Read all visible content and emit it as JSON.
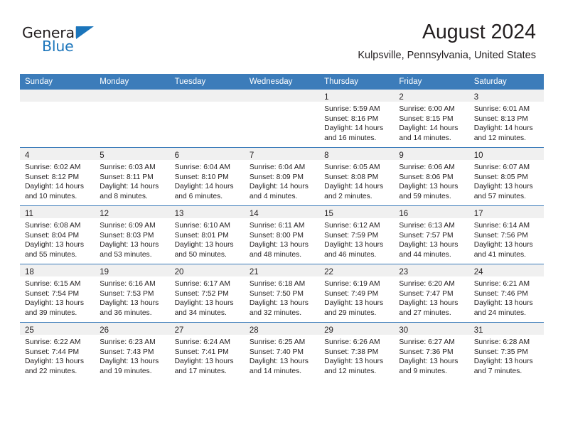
{
  "logo": {
    "word1": "General",
    "word2": "Blue",
    "triangle_color": "#1b75bb"
  },
  "header": {
    "month_title": "August 2024",
    "location": "Kulpsville, Pennsylvania, United States"
  },
  "theme": {
    "header_row_color": "#3c7cba",
    "daynum_band_color": "#f0f0f0",
    "text_color": "#231f20"
  },
  "calendar": {
    "weekday_headers": [
      "Sunday",
      "Monday",
      "Tuesday",
      "Wednesday",
      "Thursday",
      "Friday",
      "Saturday"
    ],
    "weeks": [
      [
        {
          "day": "",
          "empty": true
        },
        {
          "day": "",
          "empty": true
        },
        {
          "day": "",
          "empty": true
        },
        {
          "day": "",
          "empty": true
        },
        {
          "day": "1",
          "sunrise": "Sunrise: 5:59 AM",
          "sunset": "Sunset: 8:16 PM",
          "daylight": "Daylight: 14 hours and 16 minutes."
        },
        {
          "day": "2",
          "sunrise": "Sunrise: 6:00 AM",
          "sunset": "Sunset: 8:15 PM",
          "daylight": "Daylight: 14 hours and 14 minutes."
        },
        {
          "day": "3",
          "sunrise": "Sunrise: 6:01 AM",
          "sunset": "Sunset: 8:13 PM",
          "daylight": "Daylight: 14 hours and 12 minutes."
        }
      ],
      [
        {
          "day": "4",
          "sunrise": "Sunrise: 6:02 AM",
          "sunset": "Sunset: 8:12 PM",
          "daylight": "Daylight: 14 hours and 10 minutes."
        },
        {
          "day": "5",
          "sunrise": "Sunrise: 6:03 AM",
          "sunset": "Sunset: 8:11 PM",
          "daylight": "Daylight: 14 hours and 8 minutes."
        },
        {
          "day": "6",
          "sunrise": "Sunrise: 6:04 AM",
          "sunset": "Sunset: 8:10 PM",
          "daylight": "Daylight: 14 hours and 6 minutes."
        },
        {
          "day": "7",
          "sunrise": "Sunrise: 6:04 AM",
          "sunset": "Sunset: 8:09 PM",
          "daylight": "Daylight: 14 hours and 4 minutes."
        },
        {
          "day": "8",
          "sunrise": "Sunrise: 6:05 AM",
          "sunset": "Sunset: 8:08 PM",
          "daylight": "Daylight: 14 hours and 2 minutes."
        },
        {
          "day": "9",
          "sunrise": "Sunrise: 6:06 AM",
          "sunset": "Sunset: 8:06 PM",
          "daylight": "Daylight: 13 hours and 59 minutes."
        },
        {
          "day": "10",
          "sunrise": "Sunrise: 6:07 AM",
          "sunset": "Sunset: 8:05 PM",
          "daylight": "Daylight: 13 hours and 57 minutes."
        }
      ],
      [
        {
          "day": "11",
          "sunrise": "Sunrise: 6:08 AM",
          "sunset": "Sunset: 8:04 PM",
          "daylight": "Daylight: 13 hours and 55 minutes."
        },
        {
          "day": "12",
          "sunrise": "Sunrise: 6:09 AM",
          "sunset": "Sunset: 8:03 PM",
          "daylight": "Daylight: 13 hours and 53 minutes."
        },
        {
          "day": "13",
          "sunrise": "Sunrise: 6:10 AM",
          "sunset": "Sunset: 8:01 PM",
          "daylight": "Daylight: 13 hours and 50 minutes."
        },
        {
          "day": "14",
          "sunrise": "Sunrise: 6:11 AM",
          "sunset": "Sunset: 8:00 PM",
          "daylight": "Daylight: 13 hours and 48 minutes."
        },
        {
          "day": "15",
          "sunrise": "Sunrise: 6:12 AM",
          "sunset": "Sunset: 7:59 PM",
          "daylight": "Daylight: 13 hours and 46 minutes."
        },
        {
          "day": "16",
          "sunrise": "Sunrise: 6:13 AM",
          "sunset": "Sunset: 7:57 PM",
          "daylight": "Daylight: 13 hours and 44 minutes."
        },
        {
          "day": "17",
          "sunrise": "Sunrise: 6:14 AM",
          "sunset": "Sunset: 7:56 PM",
          "daylight": "Daylight: 13 hours and 41 minutes."
        }
      ],
      [
        {
          "day": "18",
          "sunrise": "Sunrise: 6:15 AM",
          "sunset": "Sunset: 7:54 PM",
          "daylight": "Daylight: 13 hours and 39 minutes."
        },
        {
          "day": "19",
          "sunrise": "Sunrise: 6:16 AM",
          "sunset": "Sunset: 7:53 PM",
          "daylight": "Daylight: 13 hours and 36 minutes."
        },
        {
          "day": "20",
          "sunrise": "Sunrise: 6:17 AM",
          "sunset": "Sunset: 7:52 PM",
          "daylight": "Daylight: 13 hours and 34 minutes."
        },
        {
          "day": "21",
          "sunrise": "Sunrise: 6:18 AM",
          "sunset": "Sunset: 7:50 PM",
          "daylight": "Daylight: 13 hours and 32 minutes."
        },
        {
          "day": "22",
          "sunrise": "Sunrise: 6:19 AM",
          "sunset": "Sunset: 7:49 PM",
          "daylight": "Daylight: 13 hours and 29 minutes."
        },
        {
          "day": "23",
          "sunrise": "Sunrise: 6:20 AM",
          "sunset": "Sunset: 7:47 PM",
          "daylight": "Daylight: 13 hours and 27 minutes."
        },
        {
          "day": "24",
          "sunrise": "Sunrise: 6:21 AM",
          "sunset": "Sunset: 7:46 PM",
          "daylight": "Daylight: 13 hours and 24 minutes."
        }
      ],
      [
        {
          "day": "25",
          "sunrise": "Sunrise: 6:22 AM",
          "sunset": "Sunset: 7:44 PM",
          "daylight": "Daylight: 13 hours and 22 minutes."
        },
        {
          "day": "26",
          "sunrise": "Sunrise: 6:23 AM",
          "sunset": "Sunset: 7:43 PM",
          "daylight": "Daylight: 13 hours and 19 minutes."
        },
        {
          "day": "27",
          "sunrise": "Sunrise: 6:24 AM",
          "sunset": "Sunset: 7:41 PM",
          "daylight": "Daylight: 13 hours and 17 minutes."
        },
        {
          "day": "28",
          "sunrise": "Sunrise: 6:25 AM",
          "sunset": "Sunset: 7:40 PM",
          "daylight": "Daylight: 13 hours and 14 minutes."
        },
        {
          "day": "29",
          "sunrise": "Sunrise: 6:26 AM",
          "sunset": "Sunset: 7:38 PM",
          "daylight": "Daylight: 13 hours and 12 minutes."
        },
        {
          "day": "30",
          "sunrise": "Sunrise: 6:27 AM",
          "sunset": "Sunset: 7:36 PM",
          "daylight": "Daylight: 13 hours and 9 minutes."
        },
        {
          "day": "31",
          "sunrise": "Sunrise: 6:28 AM",
          "sunset": "Sunset: 7:35 PM",
          "daylight": "Daylight: 13 hours and 7 minutes."
        }
      ]
    ]
  }
}
